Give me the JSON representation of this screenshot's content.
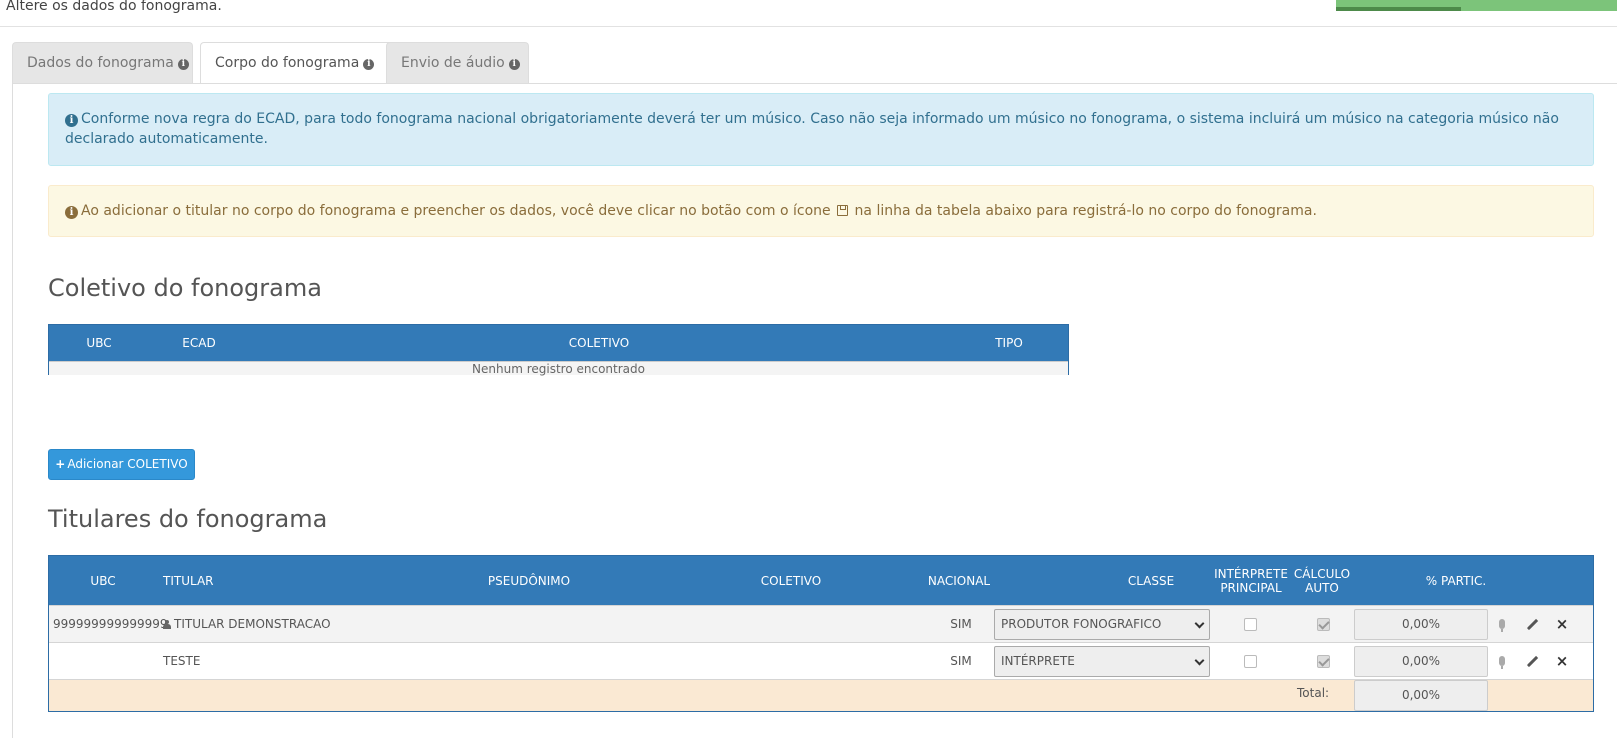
{
  "page": {
    "subtitle": "Altere os dados do fonograma."
  },
  "tabs": [
    {
      "label": "Dados do fonograma",
      "active": false
    },
    {
      "label": "Corpo do fonograma",
      "active": true
    },
    {
      "label": "Envio de áudio",
      "active": false
    }
  ],
  "alerts": {
    "info": "Conforme nova regra do ECAD, para todo fonograma nacional obrigatoriamente deverá ter um músico. Caso não seja informado um músico no fonograma, o sistema incluirá um músico na categoria músico não declarado automaticamente.",
    "warning_before": "Ao adicionar o titular no corpo do fonograma e preencher os dados, você deve clicar no botão com o ícone",
    "warning_after": "na linha da tabela abaixo para registrá-lo no corpo do fonograma."
  },
  "coletivo": {
    "title": "Coletivo do fonograma",
    "headers": {
      "ubc": "UBC",
      "ecad": "ECAD",
      "coletivo": "COLETIVO",
      "tipo": "TIPO"
    },
    "empty_message": "Nenhum registro encontrado",
    "add_button": "Adicionar COLETIVO"
  },
  "titulares": {
    "title": "Titulares do fonograma",
    "headers": {
      "ubc": "UBC",
      "titular": "TITULAR",
      "pseudonimo": "PSEUDÔNIMO",
      "coletivo": "COLETIVO",
      "nacional": "NACIONAL",
      "classe": "CLASSE",
      "interprete_principal_1": "INTÉRPRETE",
      "interprete_principal_2": "PRINCIPAL",
      "calculo_auto_1": "CÁLCULO",
      "calculo_auto_2": "AUTO",
      "partic": "% PARTIC."
    },
    "rows": [
      {
        "ubc": "999999999999999",
        "titular": "TITULAR DEMONSTRACAO",
        "pseudonimo": "",
        "coletivo": "",
        "nacional": "SIM",
        "classe": "PRODUTOR FONOGRAFICO",
        "interprete_principal": false,
        "calculo_auto": true,
        "partic": "0,00%"
      },
      {
        "ubc": "",
        "titular": "TESTE",
        "pseudonimo": "",
        "coletivo": "",
        "nacional": "SIM",
        "classe": "INTÉRPRETE",
        "interprete_principal": false,
        "calculo_auto": true,
        "partic": "0,00%"
      }
    ],
    "total_label": "Total:",
    "total_value": "0,00%"
  },
  "icons": [
    "info-circle-icon",
    "save-icon",
    "plus-icon",
    "user-icon",
    "chevron-down-icon",
    "microphone-icon",
    "pencil-icon",
    "close-icon"
  ],
  "colors": {
    "header_blue": "#337ab7",
    "button_blue": "#3498db",
    "info_bg": "#d9edf7",
    "warning_bg": "#fcf8e3",
    "total_row_bg": "#fae9d3"
  }
}
